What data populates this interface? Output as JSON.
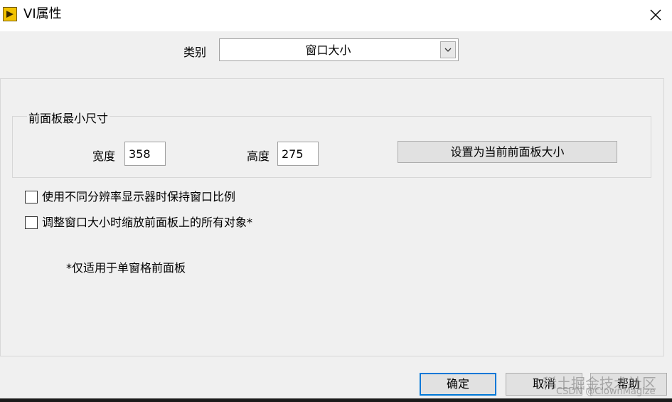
{
  "window": {
    "title": "VI属性",
    "icon": "labview-vi-icon",
    "close_icon": "close-icon"
  },
  "category": {
    "label": "类别",
    "value": "窗口大小",
    "dropdown_icon": "chevron-down-icon"
  },
  "front_panel_min": {
    "title": "前面板最小尺寸",
    "width_label": "宽度",
    "width_value": "358",
    "height_label": "高度",
    "height_value": "275",
    "set_button": "设置为当前前面板大小"
  },
  "options": [
    {
      "label": "使用不同分辨率显示器时保持窗口比例",
      "checked": false
    },
    {
      "label": "调整窗口大小时缩放前面板上的所有对象*",
      "checked": false
    }
  ],
  "footnote": "*仅适用于单窗格前面板",
  "buttons": {
    "ok": "确定",
    "cancel": "取消",
    "help": "帮助"
  },
  "watermark": {
    "line1": "稀土掘金技术社区",
    "line2": "CSDN @ClownMagize"
  },
  "colors": {
    "background": "#f0f0f0",
    "focus_border": "#0078d7",
    "icon_yellow": "#f2c200"
  }
}
